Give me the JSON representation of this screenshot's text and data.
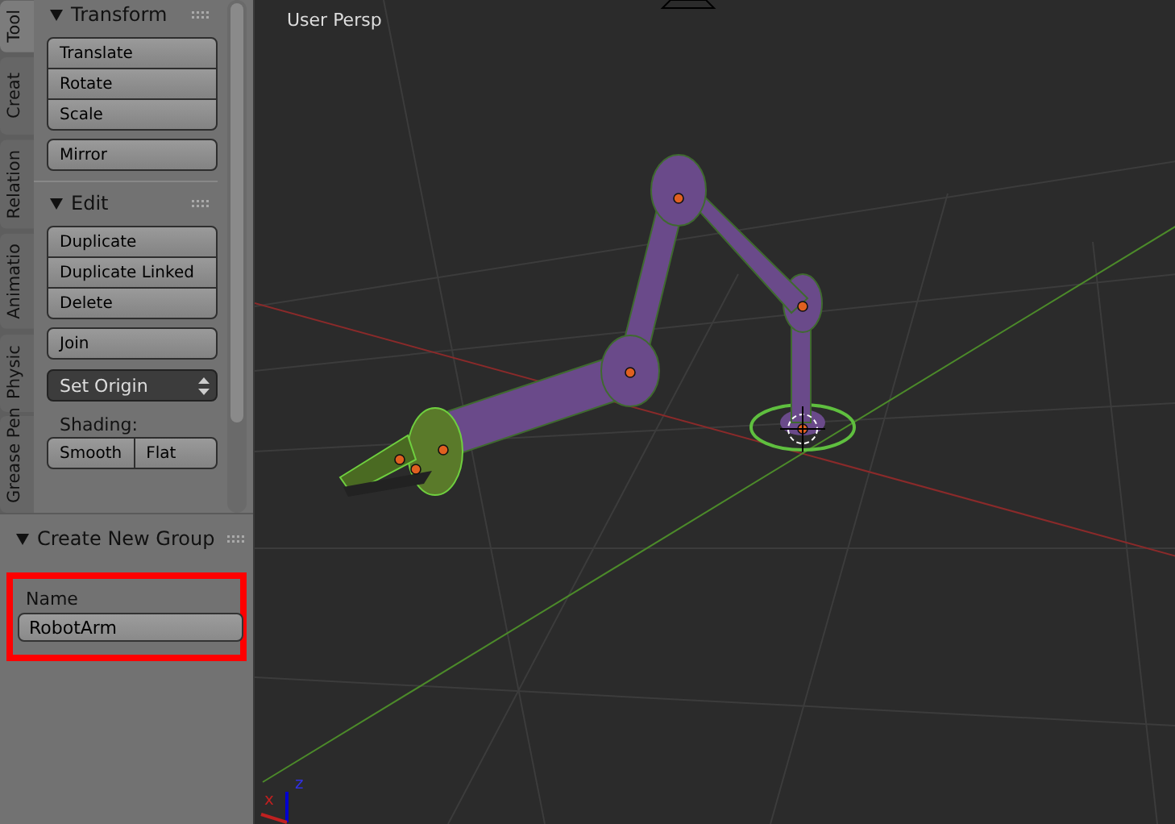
{
  "tabs": [
    {
      "label": "Tool",
      "selected": true
    },
    {
      "label": "Creat",
      "selected": false
    },
    {
      "label": "Relation",
      "selected": false
    },
    {
      "label": "Animatio",
      "selected": false
    },
    {
      "label": "Physic",
      "selected": false
    },
    {
      "label": "Grease Pen",
      "selected": false
    }
  ],
  "panels": [
    {
      "title": "Transform",
      "expanded": true,
      "items": [
        {
          "kind": "stack",
          "labels": [
            "Translate",
            "Rotate",
            "Scale"
          ]
        },
        {
          "kind": "stack",
          "labels": [
            "Mirror"
          ]
        }
      ]
    },
    {
      "title": "Edit",
      "expanded": true,
      "items": [
        {
          "kind": "stack",
          "labels": [
            "Duplicate",
            "Duplicate Linked",
            "Delete"
          ]
        },
        {
          "kind": "stack",
          "labels": [
            "Join"
          ]
        },
        {
          "kind": "dropdown",
          "label": "Set Origin"
        },
        {
          "kind": "label",
          "label": "Shading:"
        },
        {
          "kind": "row",
          "labels": [
            "Smooth",
            "Flat"
          ]
        }
      ]
    }
  ],
  "operator_panel": {
    "title": "Create New Group",
    "expanded": true,
    "field_label": "Name",
    "value": "RobotArm",
    "highlighted": true
  },
  "viewport": {
    "view_label": "User Persp",
    "axes": [
      "x",
      "z"
    ]
  }
}
